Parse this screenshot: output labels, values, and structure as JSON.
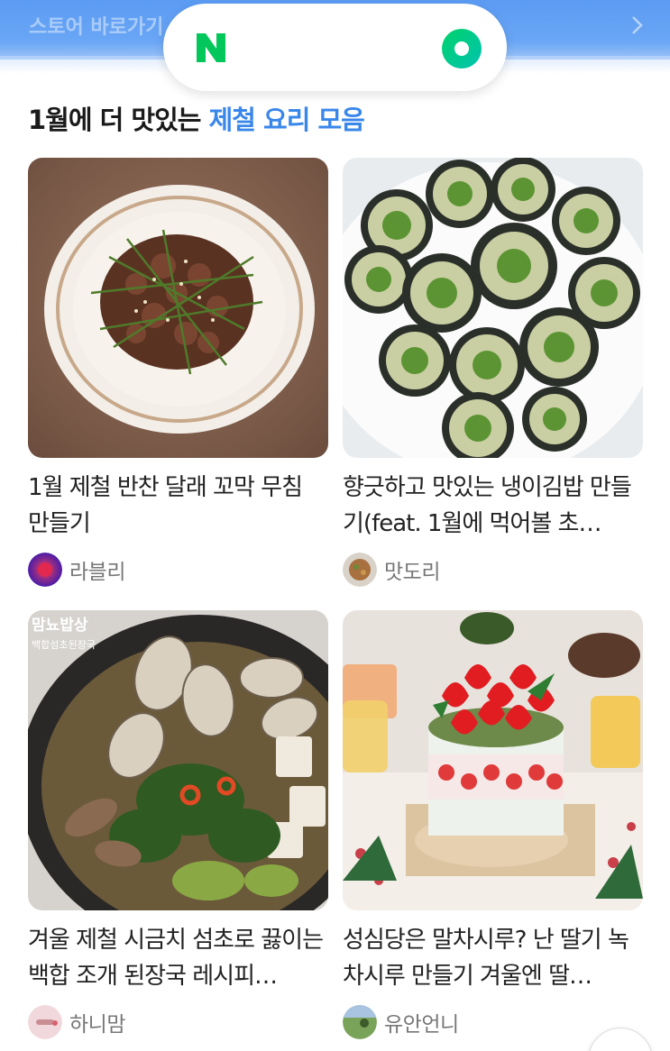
{
  "topbar": {
    "text": "스토어 바로가기"
  },
  "section": {
    "title_prefix": "1월에 더 맛있는",
    "title_accent": "제철 요리 모음"
  },
  "cards": [
    {
      "title": "1월 제철 반찬 달래 꼬막 무침 만들기",
      "author": "라블리"
    },
    {
      "title": "향긋하고 맛있는 냉이김밥 만들기(feat. 1월에 먹어볼 초…",
      "author": "맛도리"
    },
    {
      "title": "겨울 제철 시금치 섬초로 끓이는 백합 조개 된장국 레시피…",
      "author": "하니맘"
    },
    {
      "title": "성심당은 말차시루? 난 딸기 녹차시루 만들기 겨울엔 딸…",
      "author": "유안언니"
    }
  ],
  "image_overlay": {
    "card3_tag_line1": "맘뇨밥상",
    "card3_tag_line2": "백합섬초된장국"
  },
  "icons": [
    "naver-logo-icon",
    "green-circle-icon",
    "chevron-right-icon"
  ],
  "colors": {
    "accent": "#3a87ea",
    "naver_green": "#03c75a",
    "topbar": "#5b9bf3"
  }
}
